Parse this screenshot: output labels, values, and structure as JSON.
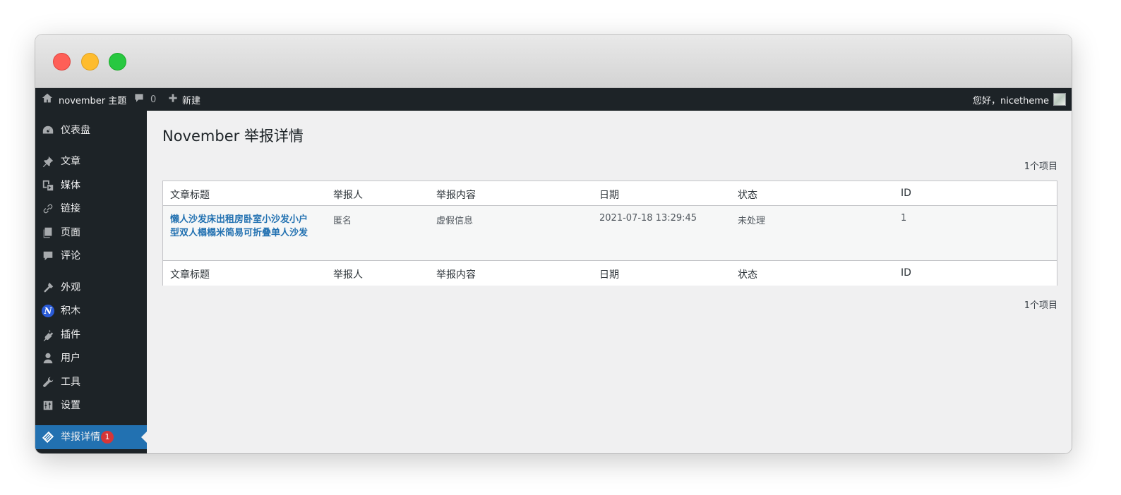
{
  "adminbar": {
    "site_name": "november 主题",
    "comments_count": "0",
    "new_label": "新建",
    "greeting": "您好，nicetheme"
  },
  "sidebar": {
    "items": [
      {
        "label": "仪表盘",
        "icon": "dashboard-icon"
      },
      {
        "label": "文章",
        "icon": "pin-icon"
      },
      {
        "label": "媒体",
        "icon": "media-icon"
      },
      {
        "label": "链接",
        "icon": "link-icon"
      },
      {
        "label": "页面",
        "icon": "pages-icon"
      },
      {
        "label": "评论",
        "icon": "comment-icon"
      },
      {
        "label": "外观",
        "icon": "appearance-icon"
      },
      {
        "label": "积木",
        "icon": "nicetheme-icon",
        "glyph": "N"
      },
      {
        "label": "插件",
        "icon": "plugin-icon"
      },
      {
        "label": "用户",
        "icon": "user-icon"
      },
      {
        "label": "工具",
        "icon": "wrench-icon"
      },
      {
        "label": "设置",
        "icon": "settings-icon"
      },
      {
        "label": "举报详情",
        "icon": "report-icon",
        "badge": "1",
        "current": true
      }
    ]
  },
  "main": {
    "title": "November 举报详情",
    "item_count": "1个项目",
    "columns": [
      "文章标题",
      "举报人",
      "举报内容",
      "日期",
      "状态",
      "ID"
    ],
    "rows": [
      {
        "title_line1": "懒人沙发床出租房卧室小沙发小户",
        "title_line2": "型双人榻榻米简易可折叠单人沙发",
        "reporter": "匿名",
        "content": "虚假信息",
        "date": "2021-07-18 13:29:45",
        "status": "未处理",
        "id": "1"
      }
    ]
  },
  "colors": {
    "admin_dark": "#1d2327",
    "accent_blue": "#2271b1",
    "badge_red": "#d63638"
  }
}
